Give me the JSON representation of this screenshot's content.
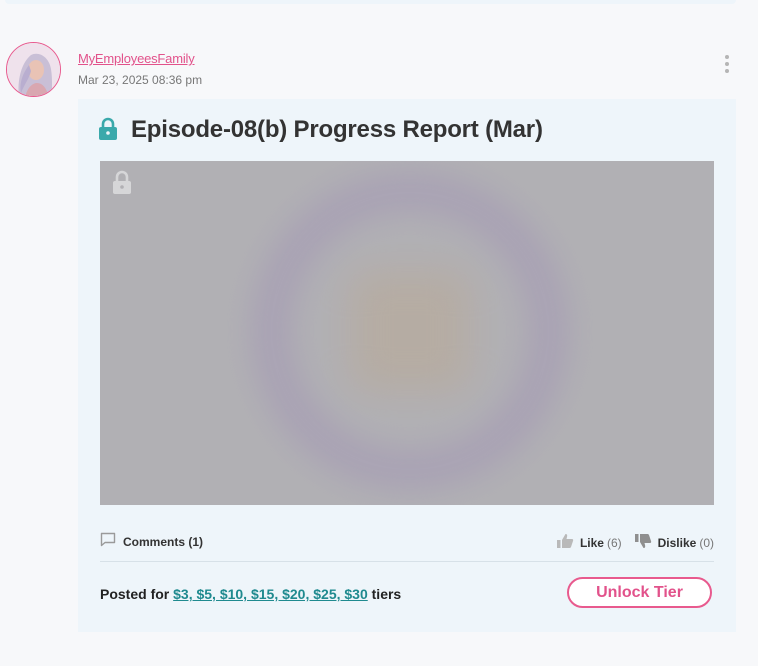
{
  "post": {
    "author": "MyEmployeesFamily",
    "date": "Mar 23, 2025 08:36 pm",
    "title": "Episode-08(b) Progress Report (Mar)",
    "comments_label": "Comments (1)",
    "like_label": "Like",
    "like_count": "(6)",
    "dislike_label": "Dislike",
    "dislike_count": "(0)",
    "posted_prefix": "Posted for",
    "tiers_link": "$3, $5, $10, $15, $20, $25, $30",
    "posted_suffix": "tiers",
    "unlock_label": "Unlock Tier"
  },
  "colors": {
    "accent_pink": "#e2528b",
    "link_teal": "#1f8a8f",
    "lock_teal": "#3aa9ab",
    "card_bg": "#eef5fa"
  },
  "icons": [
    "lock-icon",
    "lock-icon",
    "comment-icon",
    "thumbs-up-icon",
    "thumbs-down-icon",
    "more-vertical-icon"
  ]
}
